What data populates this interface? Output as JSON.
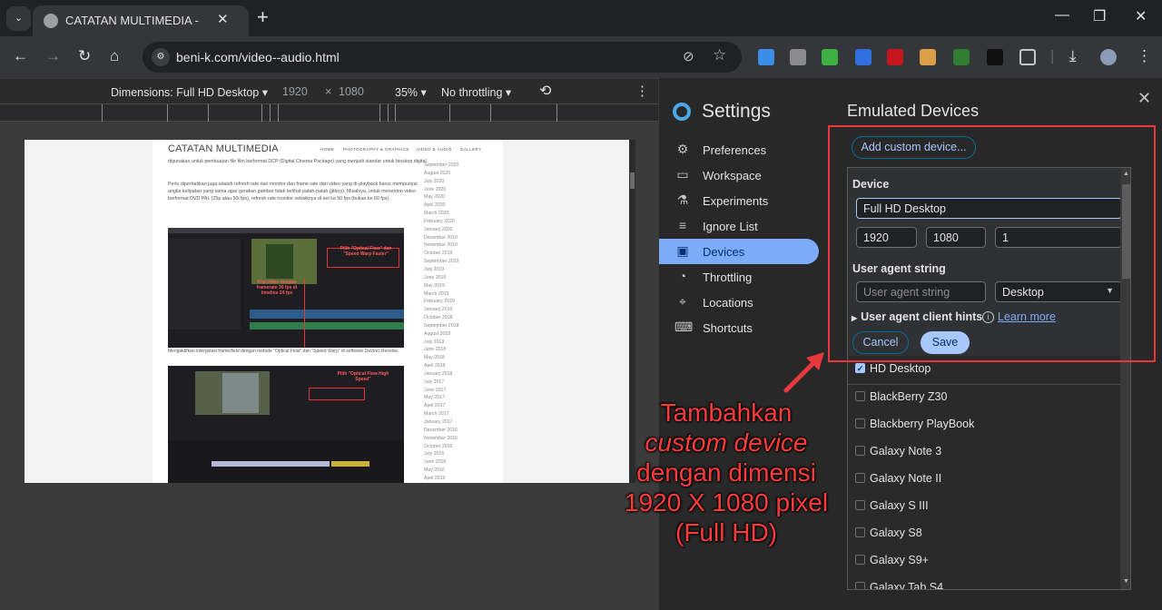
{
  "browser": {
    "tab_title": "CATATAN MULTIMEDIA - Video & Audio",
    "tab_close": "✕",
    "new_tab": "+",
    "url": "beni-k.com/video--audio.html",
    "window_controls": {
      "minimize": "—",
      "restore": "❐",
      "close": "✕"
    },
    "nav": {
      "back": "←",
      "forward": "→",
      "reload": "↻",
      "home": "⌂"
    },
    "extensions": [
      {
        "name": "s-extension-icon",
        "color": "#3a8ee6"
      },
      {
        "name": "shield-extension-icon",
        "color": "#8a8a8a"
      },
      {
        "name": "idm-extension-icon",
        "color": "#3cb043"
      },
      {
        "name": "blue-shield-extension-icon",
        "color": "#2f6fe0"
      },
      {
        "name": "acrobat-extension-icon",
        "color": "#c4161c"
      },
      {
        "name": "cookie-extension-icon",
        "color": "#d9a048"
      },
      {
        "name": "download-circle-extension-icon",
        "color": "#2e7d32"
      },
      {
        "name": "face-extension-icon",
        "color": "#111111"
      },
      {
        "name": "puzzle-extensions-icon",
        "color": "#c4c7c5"
      }
    ]
  },
  "device_toolbar": {
    "dimensions_label": "Dimensions: Full HD Desktop ▾",
    "width": "1920",
    "times": "×",
    "height": "1080",
    "zoom": "35% ▾",
    "throttling": "No throttling ▾",
    "more": "⋮"
  },
  "emulated_page": {
    "site_title": "CATATAN MULTIMEDIA",
    "nav": [
      "HOME",
      "PHOTOGRAPHY & GRAPHICS",
      "VIDEO & AUDIO",
      "GALLERY"
    ],
    "paragraph1": "digunakan untuk pembuatan file film berformat DCP (Digital Cinema Package) yang menjadi standar untuk bioskop digital.",
    "paragraph2": "Perlu diperhatikan juga adalah refresh rate dari monitor dan frame rate dari video yang di-playback harus mempunyai angka kelipatan yang sama agar gerakan gambar tidak terlihat patah-patah (jittery). Misalnya, untuk menonton video berformat DVD PAL (25p atau 50i fps), refresh rate monitor sebaiknya di-set ke 50 fps (bukan ke 60 fps).",
    "screenshot1_notes": [
      "Pilih \"Optical Flow\" dan \"Speed Warp Faster\"",
      "Klip video dengan framerate 30 fps di timeline 24 fps"
    ],
    "caption1": "Mengaktifkan interpolasi frame/field dengan metode \"Optical Flow\" dan \"Speed Warp\" di software DaVinci Resolve.",
    "screenshot2_note": "Pilih \"Optical Flow High Speed\"",
    "archive": [
      "September 2020",
      "August 2020",
      "July 2020",
      "June 2020",
      "May 2020",
      "April 2020",
      "March 2020",
      "February 2020",
      "January 2020",
      "December 2019",
      "November 2019",
      "October 2019",
      "September 2019",
      "July 2019",
      "June 2019",
      "May 2019",
      "March 2019",
      "February 2019",
      "January 2019",
      "October 2018",
      "September 2018",
      "August 2018",
      "July 2018",
      "June 2018",
      "May 2018",
      "April 2018",
      "January 2018",
      "July 2017",
      "June 2017",
      "May 2017",
      "April 2017",
      "March 2017",
      "January 2017",
      "December 2016",
      "November 2016",
      "October 2016",
      "July 2016",
      "June 2016",
      "May 2016",
      "April 2016"
    ]
  },
  "settings": {
    "title": "Settings",
    "close": "✕",
    "sidebar": [
      {
        "label": "Preferences",
        "icon": "⚙",
        "active": false
      },
      {
        "label": "Workspace",
        "icon": "▭",
        "active": false
      },
      {
        "label": "Experiments",
        "icon": "⚗",
        "active": false
      },
      {
        "label": "Ignore List",
        "icon": "≡",
        "active": false
      },
      {
        "label": "Devices",
        "icon": "▣",
        "active": true
      },
      {
        "label": "Throttling",
        "icon": "◔",
        "active": false
      },
      {
        "label": "Locations",
        "icon": "⌖",
        "active": false
      },
      {
        "label": "Shortcuts",
        "icon": "⌨",
        "active": false
      }
    ],
    "emulated_devices": {
      "heading": "Emulated Devices",
      "add_button": "Add custom device...",
      "editor": {
        "device_heading": "Device",
        "name_value": "Full HD Desktop",
        "width_value": "1920",
        "height_value": "1080",
        "dpr_value": "1",
        "ua_heading": "User agent string",
        "ua_placeholder": "User agent string",
        "ua_type": "Desktop",
        "client_hints": "User agent client hints",
        "info": "i",
        "learn_more": "Learn more",
        "cancel": "Cancel",
        "save": "Save"
      },
      "devices": [
        {
          "name": "HD Desktop",
          "checked": true
        },
        {
          "name": "BlackBerry Z30",
          "checked": false
        },
        {
          "name": "Blackberry PlayBook",
          "checked": false
        },
        {
          "name": "Galaxy Note 3",
          "checked": false
        },
        {
          "name": "Galaxy Note II",
          "checked": false
        },
        {
          "name": "Galaxy S III",
          "checked": false
        },
        {
          "name": "Galaxy S8",
          "checked": false
        },
        {
          "name": "Galaxy S9+",
          "checked": false
        },
        {
          "name": "Galaxy Tab S4",
          "checked": false
        }
      ]
    }
  },
  "annotation": {
    "line1": "Tambahkan",
    "line2": "custom device",
    "line3": "dengan dimensi",
    "line4": "1920 X 1080 pixel",
    "line5": "(Full HD)",
    "color": "#ff3a3a"
  }
}
